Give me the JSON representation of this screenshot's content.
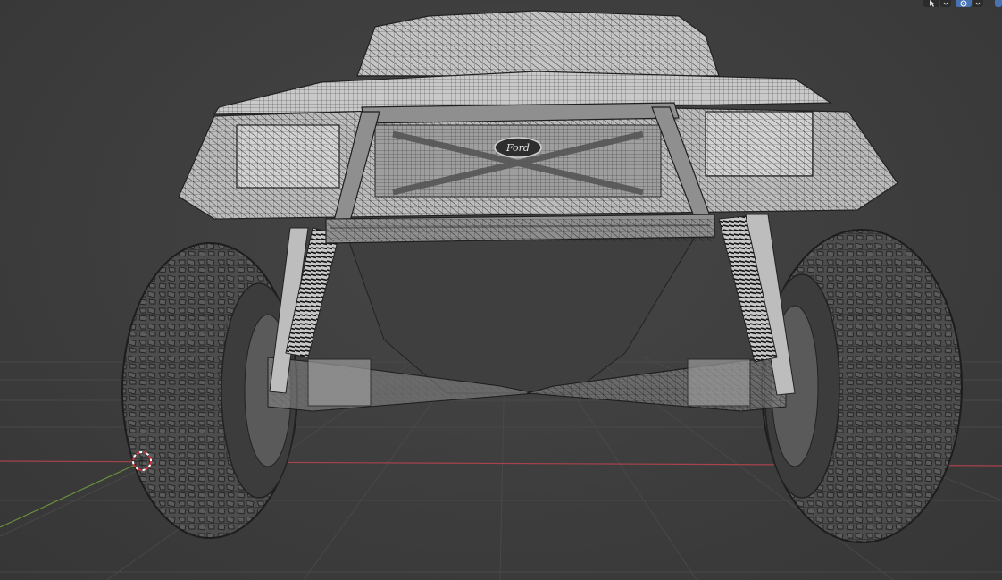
{
  "app": "Blender",
  "viewport": {
    "mode": "wireframe-over-solid",
    "object": "offroad-truck",
    "badge_text": "Ford",
    "colors": {
      "background": "#3d3d3d",
      "grid": "#4a4a4a",
      "x_axis": "#a8424c",
      "y_axis": "#6a8f3c",
      "mesh": "#bdbdbd",
      "wire": "#1e1e1e",
      "tire": "#4d4d4d",
      "cursor_red": "#d8303a",
      "header_button": "#2b2b2b",
      "header_active": "#4772b3"
    }
  },
  "header": {
    "select_icon": "cursor-select-icon",
    "overlays_icon": "overlays-icon",
    "dropdown_icon": "chevron-down-icon"
  },
  "gizmos": {
    "cursor": "3d-cursor-icon"
  }
}
